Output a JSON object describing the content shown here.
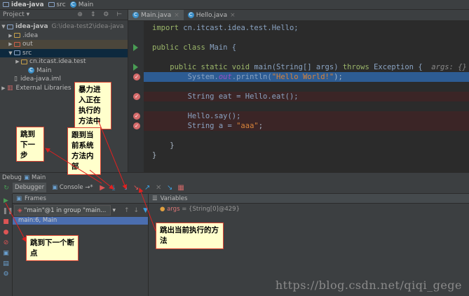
{
  "nav": {
    "project": "idea-java",
    "folder": "src",
    "file": "Main"
  },
  "project_panel": {
    "title": "Project",
    "tools": "⊕ ⇕ ⚙ ⊢"
  },
  "tree": [
    {
      "name": "idea-java",
      "path": "G:\\idea-test2\\idea-java",
      "tri": "▼"
    },
    {
      "name": ".idea",
      "tri": "▶"
    },
    {
      "name": "out",
      "tri": "▶"
    },
    {
      "name": "src",
      "tri": "▼"
    },
    {
      "name": "cn.itcast.idea.test",
      "tri": "▶"
    },
    {
      "name": "Main",
      "tri": ""
    },
    {
      "name": "idea-java.iml",
      "tri": ""
    },
    {
      "name": "External Libraries",
      "tri": "▶"
    }
  ],
  "tabs": [
    {
      "label": "Main.java"
    },
    {
      "label": "Hello.java"
    }
  ],
  "code": {
    "l1a": "import ",
    "l1b": "cn.itcast.idea.test.Hello;",
    "l2a": "public class ",
    "l2b": "Main {",
    "l3a": "    public static void ",
    "l3b": "main(String[] args) ",
    "l3c": "throws ",
    "l3d": "Exception {  ",
    "l3e": "args: {}",
    "l4a": "        System.",
    "l4b": "out",
    "l4c": ".println(",
    "l4d": "\"Hello World!\"",
    "l4e": ");",
    "l5a": "        String eat = Hello.eat();",
    "l6a": "        Hello.say();",
    "l7a": "        String a = ",
    "l7b": "\"aaa\"",
    "l7c": ";",
    "l8": "    }",
    "l9": "}"
  },
  "debug": {
    "title": "Debug",
    "config": "Main",
    "tab_debugger": "Debugger",
    "tab_console": "Console",
    "frames": "Frames",
    "variables": "Variables",
    "thread": "\"main\"@1 in group \"main...",
    "frame": "main:6, Main",
    "var_name": "args",
    "var_value": " = {String[0]@429}"
  },
  "notes": {
    "force_step_into": "暴力进入正在执行的方法中",
    "step_over": "跳到下一步",
    "step_into": "跟到当前系统方法内部",
    "resume": "跳到下一个断点",
    "step_out": "跳出当前执行的方法"
  },
  "watermark": "https://blog.csdn.net/qiqi_gege"
}
